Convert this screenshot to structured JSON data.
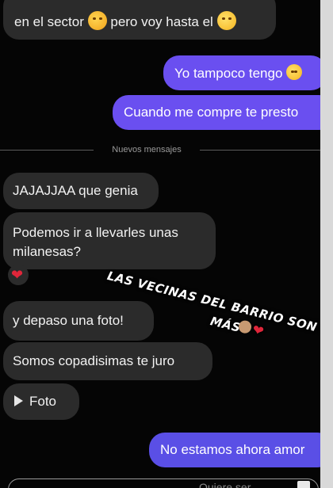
{
  "messages": {
    "partial_top": "____ __ _________ ___ __________ _______",
    "in_1_part1": "en el sector",
    "in_1_part2": "pero voy hasta el",
    "out_1": "Yo tampoco tengo",
    "out_2": "Cuando me compre te presto",
    "in_2": "JAJAJJAA que genia",
    "in_3_line1": "Podemos ir a llevarles unas",
    "in_3_line2": "milanesas?",
    "in_4": "y depaso una foto!",
    "in_5": "Somos copadisimas te juro",
    "in_6_label": "Foto",
    "out_3": "No estamos ahora amor"
  },
  "divider": {
    "label": "Nuevos mensajes"
  },
  "sticker": {
    "line1": "LAS VECINAS DEL BARRIO SON LO",
    "line2": "MÁS",
    "heart_glyph": "❤"
  },
  "reaction": {
    "heart_glyph": "❤"
  },
  "composer": {
    "hint": "Quiere ser..."
  },
  "icons": {
    "hug": "hugging-face-emoji",
    "smile": "smiling-face-emoji",
    "laugh": "laughing-face-emoji",
    "play": "play-icon",
    "heart": "red-heart-emoji",
    "hands": "clapping-hands-emoji"
  },
  "colors": {
    "outgoing_bubble": "#6a4ff0",
    "incoming_bubble": "#2b2b2b",
    "background": "#050505",
    "heart": "#e0263a"
  }
}
